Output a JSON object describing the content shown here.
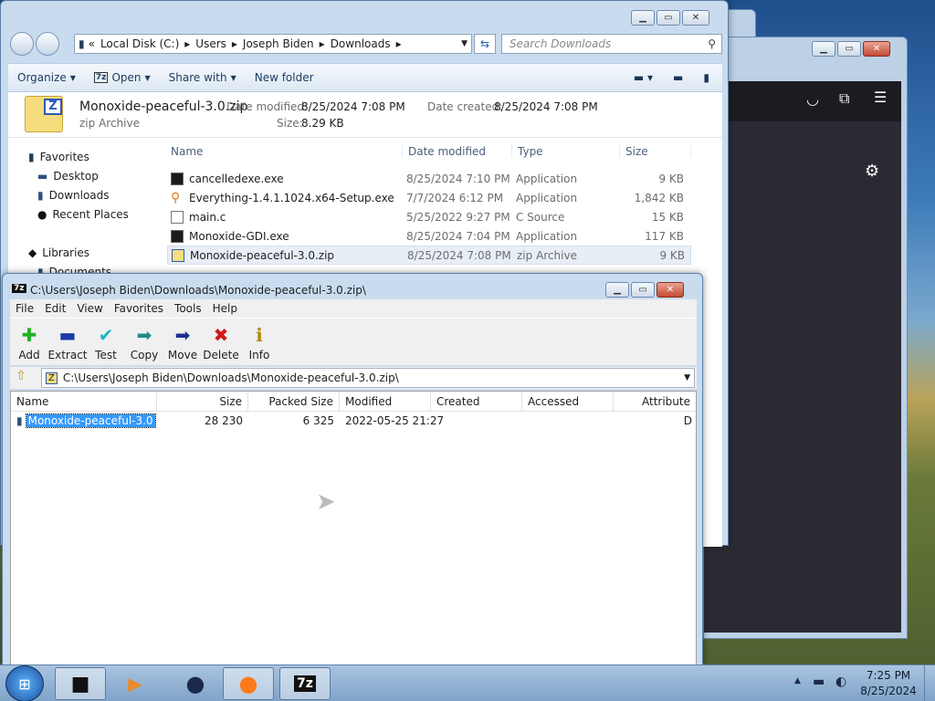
{
  "explorer": {
    "breadcrumb": [
      "Local Disk (C:)",
      "Users",
      "Joseph Biden",
      "Downloads"
    ],
    "search_placeholder": "Search Downloads",
    "commands": {
      "organize": "Organize",
      "open": "Open",
      "share": "Share with",
      "new_folder": "New folder"
    },
    "details": {
      "name": "Monoxide-peaceful-3.0.zip",
      "type": "zip Archive",
      "modified_label": "Date modified:",
      "modified": "8/25/2024 7:08 PM",
      "created_label": "Date created:",
      "created": "8/25/2024 7:08 PM",
      "size_label": "Size:",
      "size": "8.29 KB"
    },
    "nav": {
      "favorites": "Favorites",
      "desktop": "Desktop",
      "downloads": "Downloads",
      "recent": "Recent Places",
      "libraries": "Libraries",
      "documents": "Documents"
    },
    "columns": [
      "Name",
      "Date modified",
      "Type",
      "Size"
    ],
    "files": [
      {
        "name": "cancelledexe.exe",
        "date": "8/25/2024 7:10 PM",
        "type": "Application",
        "size": "9 KB",
        "icon": "app-icon"
      },
      {
        "name": "Everything-1.4.1.1024.x64-Setup.exe",
        "date": "7/7/2024 6:12 PM",
        "type": "Application",
        "size": "1,842 KB",
        "icon": "magnifier-icon"
      },
      {
        "name": "main.c",
        "date": "5/25/2022 9:27 PM",
        "type": "C Source",
        "size": "15 KB",
        "icon": "text-file-icon"
      },
      {
        "name": "Monoxide-GDI.exe",
        "date": "8/25/2024 7:04 PM",
        "type": "Application",
        "size": "117 KB",
        "icon": "app-icon"
      },
      {
        "name": "Monoxide-peaceful-3.0.zip",
        "date": "8/25/2024 7:08 PM",
        "type": "zip Archive",
        "size": "9 KB",
        "icon": "zip-icon"
      }
    ]
  },
  "sevenzip": {
    "title": "C:\\Users\\Joseph Biden\\Downloads\\Monoxide-peaceful-3.0.zip\\",
    "menu": [
      "File",
      "Edit",
      "View",
      "Favorites",
      "Tools",
      "Help"
    ],
    "toolbar": [
      "Add",
      "Extract",
      "Test",
      "Copy",
      "Move",
      "Delete",
      "Info"
    ],
    "path": "C:\\Users\\Joseph Biden\\Downloads\\Monoxide-peaceful-3.0.zip\\",
    "columns": [
      "Name",
      "Size",
      "Packed Size",
      "Modified",
      "Created",
      "Accessed",
      "Attribute"
    ],
    "items": [
      {
        "name": "Monoxide-peaceful-3.0",
        "size": "28 230",
        "packed": "6 325",
        "modified": "2022-05-25 21:27",
        "created": "",
        "accessed": "",
        "attr": "D"
      }
    ]
  },
  "tray": {
    "time": "7:25 PM",
    "date": "8/25/2024"
  }
}
